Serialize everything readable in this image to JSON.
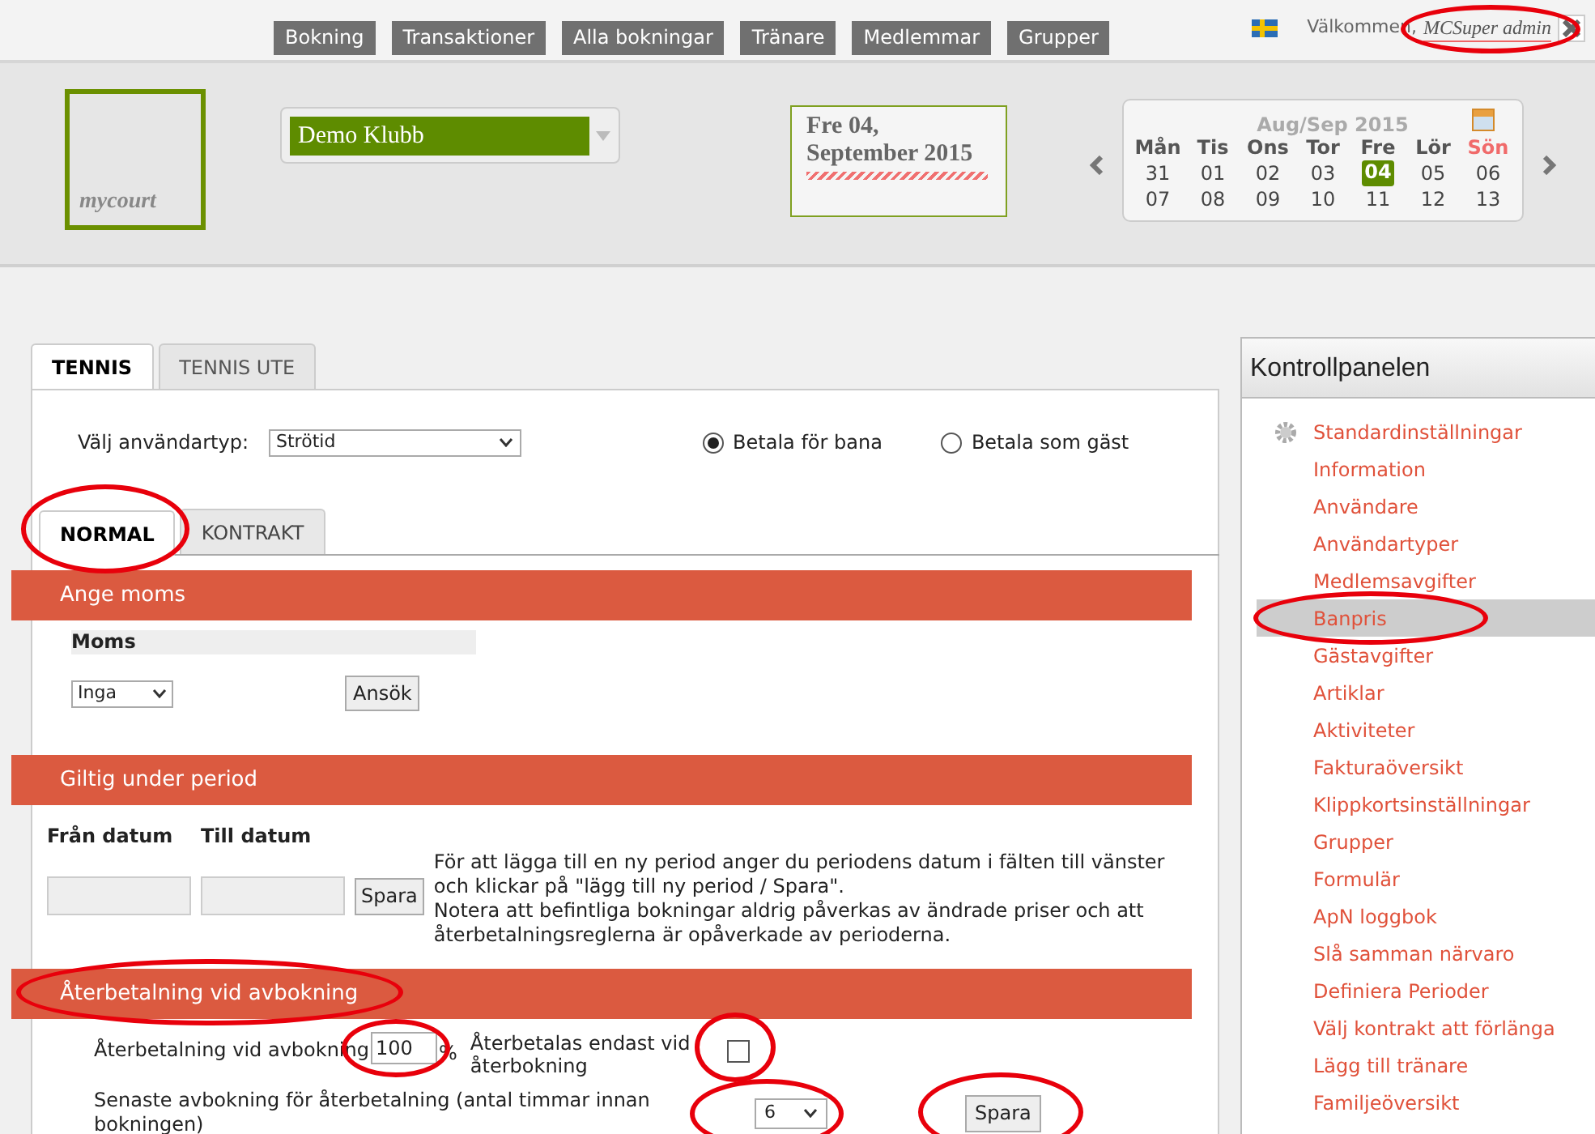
{
  "top_nav": [
    {
      "label": "Bokning"
    },
    {
      "label": "Transaktioner"
    },
    {
      "label": "Alla bokningar"
    },
    {
      "label": "Tränare"
    },
    {
      "label": "Medlemmar"
    },
    {
      "label": "Grupper"
    }
  ],
  "user": {
    "greeting": "Välkommen,",
    "name": "MCSuper admin",
    "circled": true
  },
  "logo": {
    "text": "mycourt"
  },
  "club_select": {
    "value": "Demo Klubb"
  },
  "date_card": {
    "line1": "Fre 04,",
    "line2": "September 2015"
  },
  "calendar": {
    "title": "Aug/Sep 2015",
    "weekdays": [
      {
        "label": "Mån",
        "weekend": false
      },
      {
        "label": "Tis",
        "weekend": false
      },
      {
        "label": "Ons",
        "weekend": false
      },
      {
        "label": "Tor",
        "weekend": false
      },
      {
        "label": "Fre",
        "weekend": false
      },
      {
        "label": "Lör",
        "weekend": false
      },
      {
        "label": "Sön",
        "weekend": true
      }
    ],
    "weeks": [
      [
        {
          "day": "31",
          "selected": false
        },
        {
          "day": "01",
          "selected": false
        },
        {
          "day": "02",
          "selected": false
        },
        {
          "day": "03",
          "selected": false
        },
        {
          "day": "04",
          "selected": true
        },
        {
          "day": "05",
          "selected": false
        },
        {
          "day": "06",
          "selected": false
        }
      ],
      [
        {
          "day": "07",
          "selected": false
        },
        {
          "day": "08",
          "selected": false
        },
        {
          "day": "09",
          "selected": false
        },
        {
          "day": "10",
          "selected": false
        },
        {
          "day": "11",
          "selected": false
        },
        {
          "day": "12",
          "selected": false
        },
        {
          "day": "13",
          "selected": false
        }
      ]
    ]
  },
  "court_tabs": [
    {
      "label": "TENNIS",
      "selected": true
    },
    {
      "label": "TENNIS UTE",
      "selected": false
    }
  ],
  "user_type": {
    "label": "Välj användartyp:",
    "value": "Strötid"
  },
  "payment_options": [
    {
      "label": "Betala för bana",
      "selected": true
    },
    {
      "label": "Betala som gäst",
      "selected": false
    }
  ],
  "price_tabs": [
    {
      "label": "NORMAL",
      "selected": true,
      "circled": true
    },
    {
      "label": "KONTRAKT",
      "selected": false,
      "circled": false
    }
  ],
  "sections": [
    {
      "kind": "vat",
      "title": "Ange moms",
      "circled": false,
      "column": "Moms",
      "select": "Inga",
      "button": "Ansök"
    },
    {
      "kind": "period",
      "title": "Giltig under period",
      "circled": false,
      "from_label": "Från datum",
      "to_label": "Till datum",
      "button": "Spara",
      "notes": [
        "För att lägga till en ny period anger du periodens datum i fälten till vänster och klickar på \"lägg till ny period / Spara\".",
        "Notera att befintliga bokningar aldrig påverkas av ändrade priser och att återbetalningsreglerna är opåverkade av perioderna."
      ]
    },
    {
      "kind": "refund",
      "title": "Återbetalning vid avbokning",
      "circled": true,
      "refund_label": "Återbetalning vid avbokning",
      "refund_value": "100",
      "refund_circled": true,
      "unit": "%",
      "rebook_label": "Återbetalas endast vid återbokning",
      "rebook_checked": false,
      "rebook_circled": true,
      "deadline_label": "Senaste avbokning för återbetalning (antal timmar innan bokningen)",
      "deadline_value": "6",
      "deadline_circled": true,
      "button": "Spara",
      "button_circled": true
    }
  ],
  "sidebar": {
    "title": "Kontrollpanelen",
    "items": [
      {
        "label": "Standardinställningar",
        "kind": "settings",
        "selected": false,
        "circled": false
      },
      {
        "label": "Information",
        "kind": "link",
        "selected": false,
        "circled": false
      },
      {
        "label": "Användare",
        "kind": "link",
        "selected": false,
        "circled": false
      },
      {
        "label": "Användartyper",
        "kind": "link",
        "selected": false,
        "circled": false
      },
      {
        "label": "Medlemsavgifter",
        "kind": "link",
        "selected": false,
        "circled": false
      },
      {
        "label": "Banpris",
        "kind": "link",
        "selected": true,
        "circled": true
      },
      {
        "label": "Gästavgifter",
        "kind": "link",
        "selected": false,
        "circled": false
      },
      {
        "label": "Artiklar",
        "kind": "link",
        "selected": false,
        "circled": false
      },
      {
        "label": "Aktiviteter",
        "kind": "link",
        "selected": false,
        "circled": false
      },
      {
        "label": "Fakturaöversikt",
        "kind": "link",
        "selected": false,
        "circled": false
      },
      {
        "label": "Klippkortsinställningar",
        "kind": "link",
        "selected": false,
        "circled": false
      },
      {
        "label": "Grupper",
        "kind": "link",
        "selected": false,
        "circled": false
      },
      {
        "label": "Formulär",
        "kind": "link",
        "selected": false,
        "circled": false
      },
      {
        "label": "ApN loggbok",
        "kind": "link",
        "selected": false,
        "circled": false
      },
      {
        "label": "Slå samman närvaro",
        "kind": "link",
        "selected": false,
        "circled": false
      },
      {
        "label": "Definiera Perioder",
        "kind": "link",
        "selected": false,
        "circled": false
      },
      {
        "label": "Välj kontrakt att förlänga",
        "kind": "link",
        "selected": false,
        "circled": false
      },
      {
        "label": "Lägg till tränare",
        "kind": "link",
        "selected": false,
        "circled": false
      },
      {
        "label": "Familjeöversikt",
        "kind": "link",
        "selected": false,
        "circled": false
      }
    ]
  }
}
